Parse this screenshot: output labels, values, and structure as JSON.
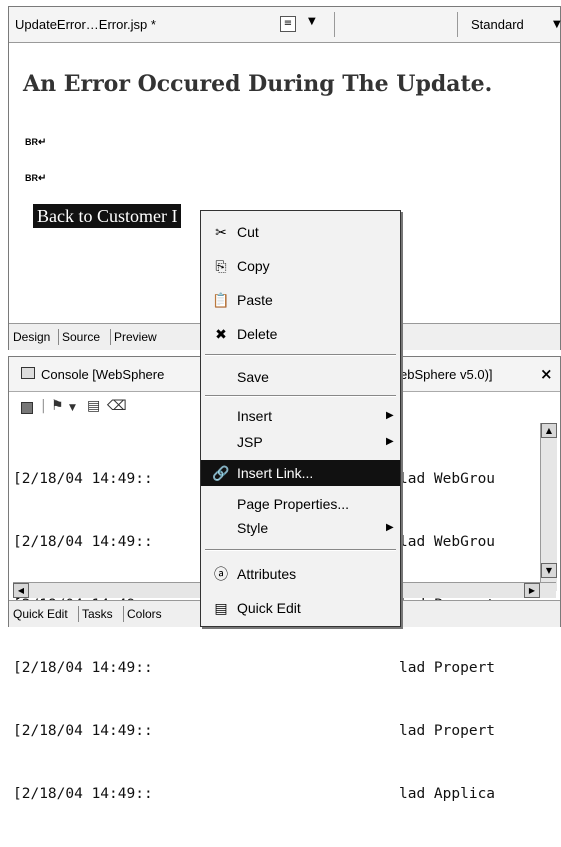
{
  "editor": {
    "tab_title": "UpdateError…Error.jsp *",
    "format_icon": "paragraph-format-icon",
    "style_label": "Standard",
    "heading": "An Error Occured During The Update.",
    "br_tag": "BR",
    "link_text": "Back to Customer I",
    "view_tabs": [
      "Design",
      "Source",
      "Preview"
    ]
  },
  "console": {
    "title_left": "Console [WebSphere",
    "title_right": "ebSphere v5.0)]",
    "close_label": "×",
    "tool_icons": [
      "stop-icon",
      "run-icon",
      "dropdown-icon",
      "clear-icon",
      "pin-icon"
    ],
    "log_left": [
      "[2/18/04 14:49::",
      "[2/18/04 14:49::",
      "[2/18/04 14:49::",
      "[2/18/04 14:49::",
      "[2/18/04 14:49::",
      "[2/18/04 14:49::"
    ],
    "log_right": [
      "lad WebGrou",
      "lad WebGrou",
      "lad Propert",
      "lad Propert",
      "lad Propert",
      "lad Applica"
    ],
    "bottom_tabs": [
      "Quick Edit",
      "Tasks",
      "Colors"
    ]
  },
  "context_menu": {
    "items": [
      {
        "label": "Cut",
        "icon": "scissors-icon",
        "glyph": "✂"
      },
      {
        "label": "Copy",
        "icon": "copy-icon",
        "glyph": "⎘"
      },
      {
        "label": "Paste",
        "icon": "paste-icon",
        "glyph": "📋"
      },
      {
        "label": "Delete",
        "icon": "delete-icon",
        "glyph": "✖"
      },
      {
        "label": "Save"
      },
      {
        "label": "Insert",
        "submenu": true
      },
      {
        "label": "JSP",
        "submenu": true
      },
      {
        "label": "Insert Link...",
        "icon": "link-icon",
        "glyph": "🔗",
        "highlighted": true
      },
      {
        "label": "Page Properties..."
      },
      {
        "label": "Style",
        "submenu": true
      },
      {
        "label": "Attributes",
        "icon": "attributes-icon",
        "glyph": "ⓐ"
      },
      {
        "label": "Quick Edit",
        "icon": "quick-edit-icon",
        "glyph": "▤"
      }
    ],
    "submenu_arrow": "▶",
    "highlight_color": "#111111"
  }
}
